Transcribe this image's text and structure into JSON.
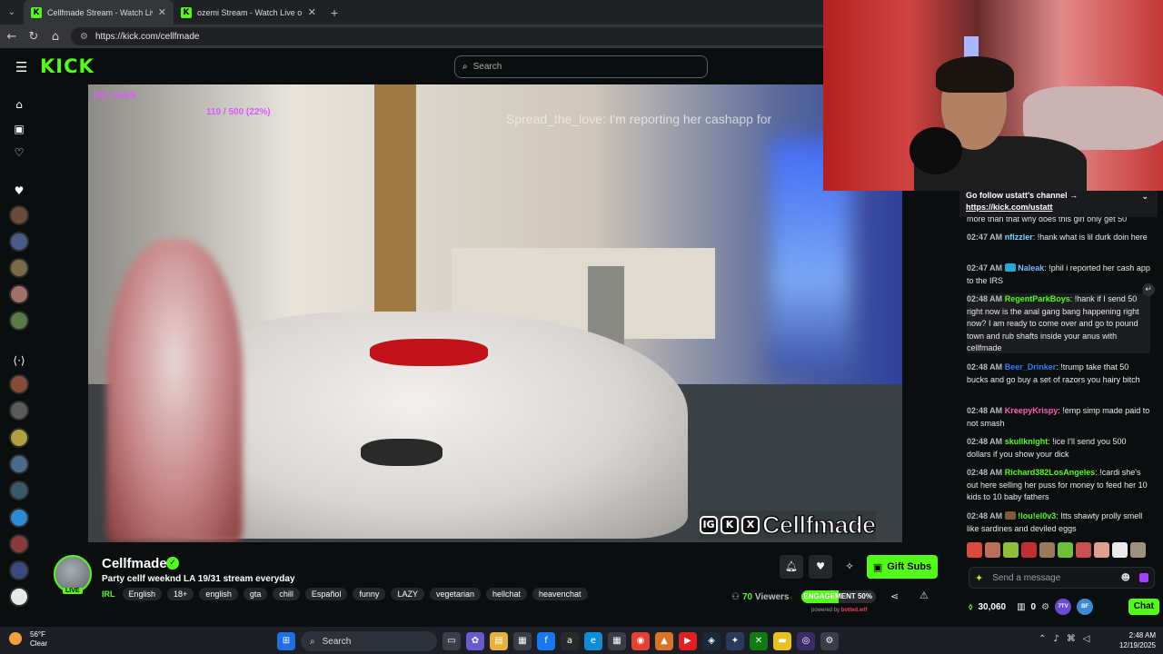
{
  "browser": {
    "tabs": [
      {
        "title": "Cellfmade Stream - Watch Liv"
      },
      {
        "title": "ozemi Stream - Watch Live o"
      }
    ],
    "url": "https://kick.com/cellfmade"
  },
  "header": {
    "logo": "KICK",
    "search_placeholder": "Search"
  },
  "video_overlay": {
    "subs_label": "DEC SUBS",
    "goal": "110 / 500 (22%)",
    "ticker": "Spread_the_love: I'm reporting her cashapp for",
    "brand": "Cellfmade",
    "brand_icons": [
      "IG",
      "K",
      "X"
    ]
  },
  "chat": {
    "pinned_line1": "Go follow ustatt's channel →",
    "pinned_line2": "https://kick.com/ustatt",
    "cut_message": "more than that why does this girl only get 50",
    "messages": [
      {
        "time": "02:47 AM",
        "user": "nfizzler",
        "color": "#7ad9ff",
        "badge": false,
        "text": "!hank what is lil durk doin here"
      },
      {
        "time": "02:47 AM",
        "user": "Naleak",
        "color": "#7ab7ff",
        "badge": true,
        "text": "!phil i reported her cash app to the IRS"
      },
      {
        "time": "02:48 AM",
        "user": "RegentParkBoys",
        "color": "#53fc18",
        "badge": false,
        "text": "!hank if I send 50 right now is the anal gang bang happening right now? I am ready to come over and go to pound town and rub shafts inside your anus with cellfmade"
      },
      {
        "time": "02:48 AM",
        "user": "Beer_Drinker",
        "color": "#2f7dff",
        "badge": false,
        "text": "!trump take that 50 bucks and go buy a set of razors you hairy bitch"
      },
      {
        "time": "02:48 AM",
        "user": "KreepyKrispy",
        "color": "#ff5cb8",
        "badge": false,
        "text": "!emp simp made paid to not smash"
      },
      {
        "time": "02:48 AM",
        "user": "skullknight",
        "color": "#53fc18",
        "badge": false,
        "text": "!ice I'll send you 500 dollars if you show your dick"
      },
      {
        "time": "02:48 AM",
        "user": "Richard382LosAngeles",
        "color": "#53fc18",
        "badge": false,
        "text": "!cardi she's out here selling her puss for money to feed her 10 kids to 10 baby fathers"
      },
      {
        "time": "02:48 AM",
        "user": "!lou!el0v3",
        "color": "#53fc18",
        "badge": false,
        "text": "Itts shawty prolly smell like sardines and deviled eggs"
      }
    ],
    "send_placeholder": "Send a message",
    "points": "30,060",
    "drops": "0",
    "ext1": "7TV",
    "ext2": "BF",
    "chat_button": "Chat",
    "emote_colors": [
      "#d94a3a",
      "#b8705a",
      "#8fbf3a",
      "#c03030",
      "#9a7a5a",
      "#6fbf3a",
      "#c85050",
      "#e0a090",
      "#eaeaea",
      "#a09080"
    ]
  },
  "channel": {
    "name": "Cellfmade",
    "live_label": "LIVE",
    "title": "Party cellf weeknd LA 19/31 stream everyday",
    "category": "IRL",
    "tags": [
      "English",
      "18+",
      "english",
      "gta",
      "chill",
      "Español",
      "funny",
      "LAZY",
      "vegetarian",
      "hellchat",
      "heavenchat"
    ],
    "gift_button": "Gift Subs",
    "viewers_count": "70",
    "viewers_label": "Viewers",
    "engagement_label": "ENGAGEMENT 50%",
    "engagement_value": 0.5,
    "powered_prefix": "powered by",
    "powered_by": "botted.wtf"
  },
  "taskbar": {
    "temperature": "56°F",
    "condition": "Clear",
    "search": "Search",
    "time": "2:48 AM",
    "date": "12/19/2025"
  }
}
